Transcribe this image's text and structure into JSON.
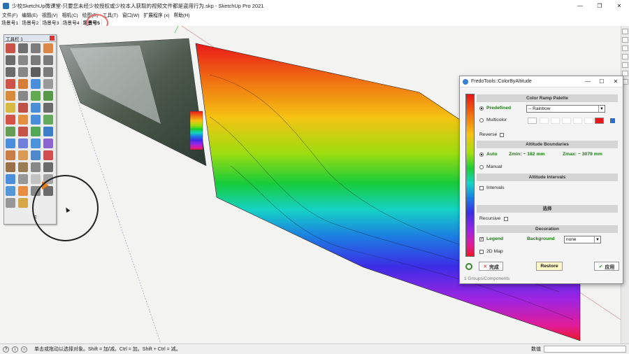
{
  "window": {
    "title": "少校SketchUp微课堂-只要您未经少校授权或少校本人获取的视频文件都是盗用行为.skp - SketchUp Pro 2021",
    "minimize": "—",
    "maximize": "❐",
    "close": "✕"
  },
  "menu": [
    "文件(F)",
    "编辑(E)",
    "视图(V)",
    "相机(C)",
    "绘图(R)",
    "工具(T)",
    "窗口(W)",
    "扩展程序 (x)",
    "帮助(H)"
  ],
  "scenes": [
    "场景号1",
    "场景号2",
    "场景号3",
    "场景号4",
    "场景号5"
  ],
  "active_scene_index": 4,
  "toolbar": {
    "title": "工具栏 1",
    "icon_colors": [
      "#c23a2a",
      "#5a5a5a",
      "#6a6a6a",
      "#d9762b",
      "#555",
      "#777",
      "#666",
      "#666",
      "#555",
      "#777",
      "#444",
      "#666",
      "#c8392b",
      "#d46a1b",
      "#2f7ed8",
      "#8c8c8c",
      "#d47a1c",
      "#777",
      "#4a9e3a",
      "#3d8a2e",
      "#d5b024",
      "#b8362a",
      "#2e7fd1",
      "#555",
      "#cc3a2a",
      "#e07f22",
      "#2d7ed6",
      "#4e9e43",
      "#4d8f3a",
      "#c0392b",
      "#3a9b3c",
      "#1e6bc2",
      "#2f7ed8",
      "#5a6ed6",
      "#2e82d6",
      "#7b4ec9",
      "#c36a2a",
      "#d68c3a",
      "#3478c7",
      "#c33",
      "#8c5a2a",
      "#8b6a3a",
      "#777",
      "#555",
      "#2f7ed8",
      "#888",
      "#bbb",
      "#999",
      "#3b87d4",
      "#e67e22",
      "#777",
      "#555",
      "#888",
      "#d49b2a"
    ],
    "bottom_label": "E"
  },
  "dialog": {
    "title": "FredoTools::ColorByAltitude",
    "sections": {
      "ramp": "Color Ramp Palette",
      "boundaries": "Altitude Boundaries",
      "intervals": "Altitude Intervals",
      "select": "选择",
      "decoration": "Decoration"
    },
    "predefined_label": "Predefined",
    "predefined_value": "-- Rainbow",
    "multicolor_label": "Multicolor",
    "reverse_label": "Reverse",
    "auto_label": "Auto",
    "zmin": "Zmin:  ~ 182 mm",
    "zmax": "Zmax:  ~ 3079 mm",
    "manual_label": "Manual",
    "intervals_label": "Intervals",
    "recursive_label": "Recursive",
    "legend_label": "Legend",
    "background_label": "Background",
    "background_value": "none",
    "map2d_label": "2D Map",
    "finish_label": "完成",
    "restore_label": "Restore",
    "apply_label": "应用",
    "status": "1 Groups/Components"
  },
  "status_bar": {
    "hint": "单击或拖动以选择对象。Shift = 加/减。Ctrl = 加。Shift + Ctrl = 减。",
    "measurement_label": "数值"
  }
}
